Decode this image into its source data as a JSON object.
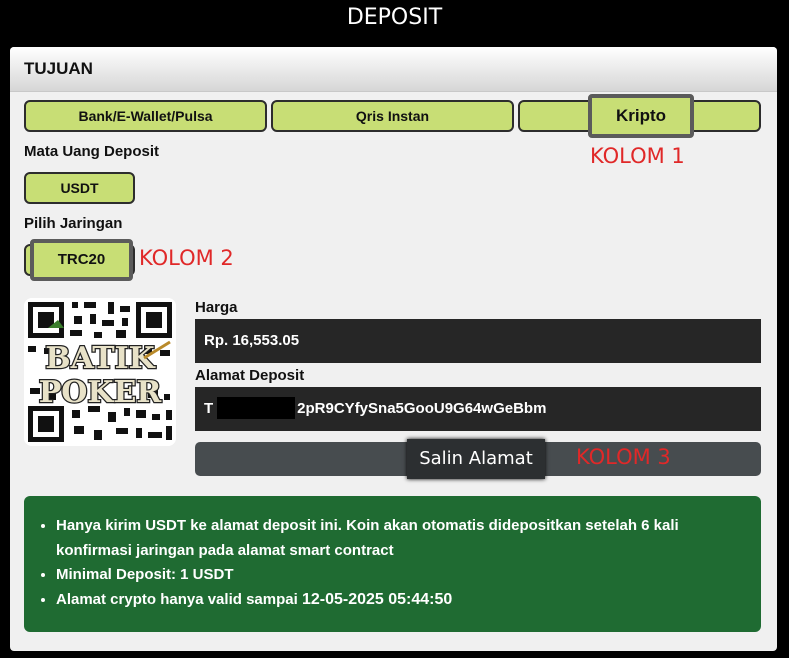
{
  "title": "DEPOSIT",
  "panel": {
    "header": "TUJUAN"
  },
  "methods": [
    "Bank/E-Wallet/Pulsa",
    "Qris Instan",
    "Kripto"
  ],
  "currency": {
    "label": "Mata Uang Deposit",
    "value": "USDT"
  },
  "network": {
    "label": "Pilih Jaringan",
    "value": "TRC20"
  },
  "annotations": {
    "kolom1": "KOLOM 1",
    "kolom2": "KOLOM 2",
    "kolom3": "KOLOM 3"
  },
  "logo": {
    "line1": "BATIK",
    "line2": "POKER"
  },
  "price": {
    "label": "Harga",
    "value": "Rp. 16,553.05"
  },
  "address": {
    "label": "Alamat Deposit",
    "prefix": "T",
    "visible": "2pR9CYfySna5GooU9G64wGeBbm"
  },
  "copy_button": "Salin Alamat",
  "info": {
    "items": [
      "Hanya kirim USDT ke alamat deposit ini. Koin akan otomatis didepositkan setelah 6 kali konfirmasi jaringan pada alamat smart contract",
      "Minimal Deposit: 1 USDT"
    ],
    "validity_text": "Alamat crypto hanya valid sampai ",
    "validity_time": "12-05-2025 05:44:50"
  },
  "colors": {
    "button_green": "#c8de75",
    "info_green": "#1f6b32",
    "annotation_red": "#e02828"
  },
  "icons": {
    "qr": "qr-code-icon"
  }
}
